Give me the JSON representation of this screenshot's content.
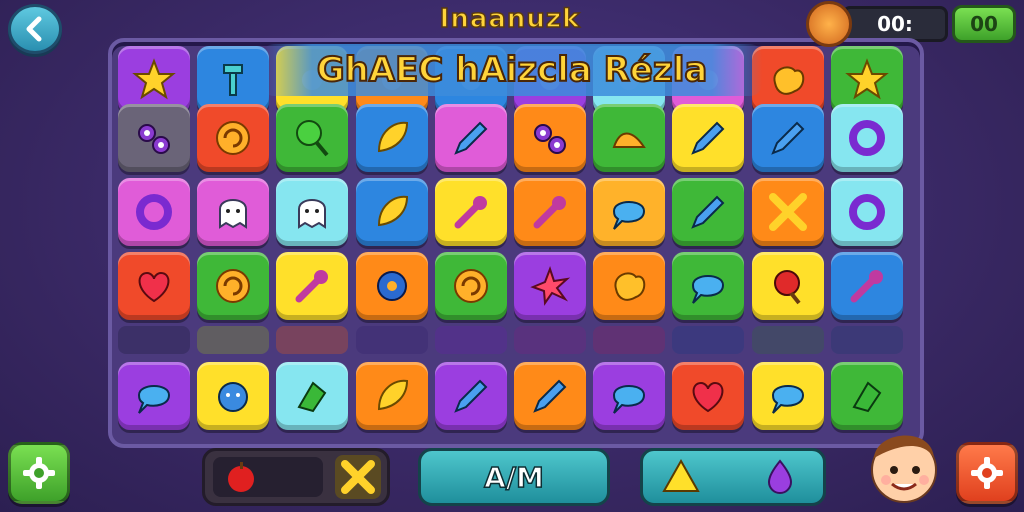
{
  "header": {
    "title": "Inaanuzk"
  },
  "hud": {
    "timer": "00:",
    "score": "00"
  },
  "banner": {
    "text": "GhAEC hAizcla Rézla"
  },
  "bottom": {
    "play_label": "A/M"
  },
  "colors": {
    "purple": "#9b3ee0",
    "blue": "#2d86e0",
    "orange": "#ff8a18",
    "green": "#3fb838",
    "red": "#f04a2a",
    "yellow": "#ffe02a",
    "cyan": "#86e6f0",
    "magenta": "#e05cd8",
    "gray": "#6a6478",
    "amber": "#ffb22a"
  },
  "board": {
    "rows": [
      [
        {
          "c": "purple",
          "i": "star"
        },
        {
          "c": "blue",
          "i": "tool"
        },
        {
          "c": "yellow",
          "i": "pin"
        },
        {
          "c": "orange",
          "i": "pin"
        },
        {
          "c": "blue",
          "i": "pin"
        },
        {
          "c": "purple",
          "i": "pin"
        },
        {
          "c": "cyan",
          "i": "pin"
        },
        {
          "c": "magenta",
          "i": "pin"
        },
        {
          "c": "red",
          "i": "blob"
        },
        {
          "c": "green",
          "i": "star"
        }
      ],
      [
        {
          "c": "gray",
          "i": "link"
        },
        {
          "c": "red",
          "i": "swirl"
        },
        {
          "c": "green",
          "i": "balloon"
        },
        {
          "c": "blue",
          "i": "leaf"
        },
        {
          "c": "magenta",
          "i": "pencil"
        },
        {
          "c": "orange",
          "i": "link"
        },
        {
          "c": "green",
          "i": "horn"
        },
        {
          "c": "yellow",
          "i": "pencil"
        },
        {
          "c": "blue",
          "i": "pencil"
        },
        {
          "c": "cyan",
          "i": "ring"
        }
      ],
      [
        {
          "c": "magenta",
          "i": "ring"
        },
        {
          "c": "magenta",
          "i": "ghost"
        },
        {
          "c": "cyan",
          "i": "ghost"
        },
        {
          "c": "blue",
          "i": "leaf"
        },
        {
          "c": "yellow",
          "i": "wrench"
        },
        {
          "c": "orange",
          "i": "wrench"
        },
        {
          "c": "amber",
          "i": "bubble"
        },
        {
          "c": "green",
          "i": "pencil"
        },
        {
          "c": "orange",
          "i": "cross"
        },
        {
          "c": "cyan",
          "i": "ring"
        }
      ],
      [
        {
          "c": "red",
          "i": "heart"
        },
        {
          "c": "green",
          "i": "swirl"
        },
        {
          "c": "yellow",
          "i": "wrench"
        },
        {
          "c": "orange",
          "i": "gear"
        },
        {
          "c": "green",
          "i": "swirl"
        },
        {
          "c": "purple",
          "i": "burst"
        },
        {
          "c": "orange",
          "i": "blob"
        },
        {
          "c": "green",
          "i": "bubble"
        },
        {
          "c": "yellow",
          "i": "mallet"
        },
        {
          "c": "blue",
          "i": "wrench"
        }
      ],
      [
        {
          "c": "purple",
          "i": "bubble"
        },
        {
          "c": "yellow",
          "i": "head"
        },
        {
          "c": "cyan",
          "i": "hand"
        },
        {
          "c": "orange",
          "i": "leaf"
        },
        {
          "c": "purple",
          "i": "pencil"
        },
        {
          "c": "orange",
          "i": "pencil"
        },
        {
          "c": "purple",
          "i": "bubble"
        },
        {
          "c": "red",
          "i": "heart"
        },
        {
          "c": "yellow",
          "i": "bubble"
        },
        {
          "c": "green",
          "i": "hand"
        }
      ]
    ],
    "strip_colors": [
      "#2a2550",
      "#7a8a40",
      "#b0503a",
      "#3a2a70",
      "#5a2a9a",
      "#6a2a80",
      "#7a2a6a",
      "#2a3a80",
      "#3a5a50",
      "#2a3a70"
    ]
  }
}
